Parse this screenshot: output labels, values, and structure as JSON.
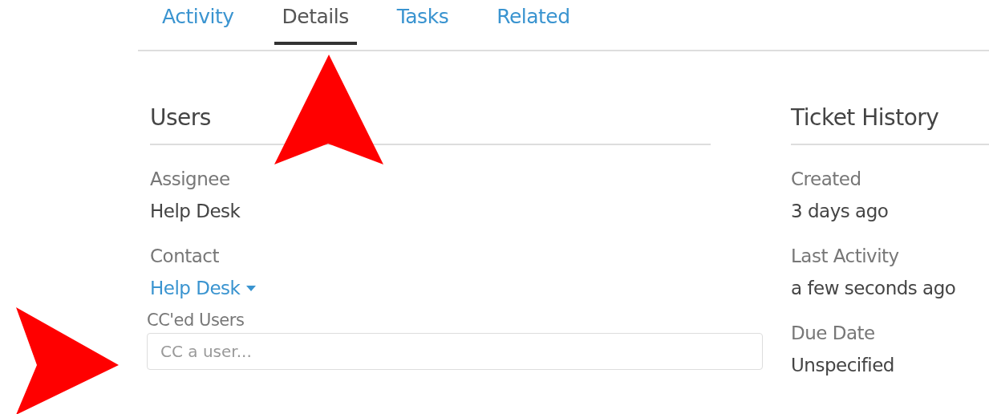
{
  "tabs": [
    {
      "label": "Activity",
      "selected": false
    },
    {
      "label": "Details",
      "selected": true
    },
    {
      "label": "Tasks",
      "selected": false
    },
    {
      "label": "Related",
      "selected": false
    }
  ],
  "users": {
    "title": "Users",
    "fields": [
      {
        "kind": "text",
        "label": "Assignee",
        "value": "Help Desk"
      },
      {
        "kind": "dropdown",
        "label": "Contact",
        "value": "Help Desk"
      },
      {
        "kind": "input",
        "label": "CC'ed Users",
        "placeholder": "CC a user..."
      }
    ]
  },
  "ticket_history": {
    "title": "Ticket History",
    "fields": [
      {
        "label": "Created",
        "value": "3 days ago"
      },
      {
        "label": "Last Activity",
        "value": "a few seconds ago"
      },
      {
        "label": "Due Date",
        "value": "Unspecified"
      }
    ]
  }
}
